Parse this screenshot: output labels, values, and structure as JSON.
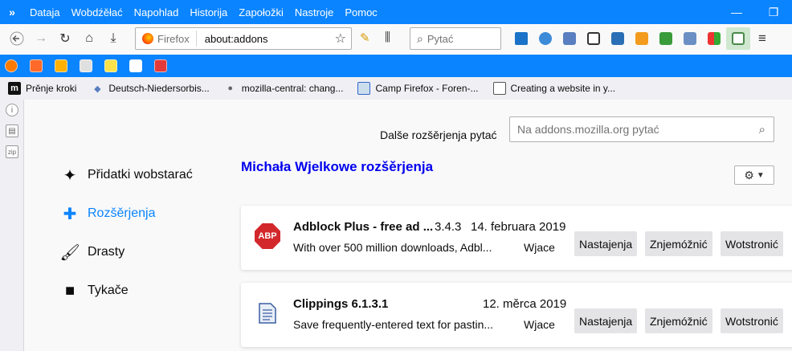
{
  "menubar": {
    "items": [
      "Dataja",
      "Wobdźěłać",
      "Napohlad",
      "Historija",
      "Zapołožki",
      "Nastroje",
      "Pomoc"
    ]
  },
  "navbar": {
    "identity_label": "Firefox",
    "url": "about:addons",
    "search_placeholder": "Pytać"
  },
  "bookmarks": [
    {
      "label": "Prěnje kroki",
      "icon": "m-icon"
    },
    {
      "label": "Deutsch-Niedersorbis...",
      "icon": "puzzle-icon"
    },
    {
      "label": "mozilla-central: chang...",
      "icon": "mercurial-icon"
    },
    {
      "label": "Camp Firefox - Foren-...",
      "icon": "forum-icon"
    },
    {
      "label": "Creating a website in y...",
      "icon": "page-icon"
    }
  ],
  "addons_page": {
    "find_more_label": "Dalše rozšěrjenja pytać",
    "amo_search_placeholder": "Na addons.mozilla.org pytać",
    "categories": [
      {
        "label": "Přidatki wobstarać",
        "icon": "sparkle-icon"
      },
      {
        "label": "Rozšěrjenja",
        "icon": "puzzle-icon",
        "selected": true
      },
      {
        "label": "Drasty",
        "icon": "brush-icon"
      },
      {
        "label": "Tykače",
        "icon": "plugin-icon"
      }
    ],
    "heading": "Michała Wjelkowe rozšěrjenja",
    "addons": [
      {
        "name": "Adblock Plus - free ad ...",
        "version": "3.4.3",
        "date": "14. februara 2019",
        "description": "With over 500 million downloads, Adbl...",
        "more": "Wjace",
        "buttons": [
          "Nastajenja",
          "Znjemóžnić",
          "Wotstronić"
        ],
        "icon": "abp-icon"
      },
      {
        "name": "Clippings 6.1.3.1",
        "version": "",
        "date": "12. měrca 2019",
        "description": "Save frequently-entered text for pastin...",
        "more": "Wjace",
        "buttons": [
          "Nastajenja",
          "Znjemóžnić",
          "Wotstronić"
        ],
        "icon": "clippings-icon"
      }
    ]
  },
  "colors": {
    "accent": "#0a84ff",
    "heading": "#0000ee",
    "abp_red": "#d3282b"
  }
}
